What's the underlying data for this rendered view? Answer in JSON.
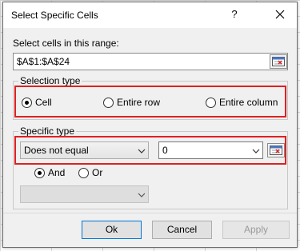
{
  "window": {
    "title": "Select Specific Cells",
    "help_label": "?"
  },
  "range": {
    "label": "Select cells in this range:",
    "value": "$A$1:$A$24"
  },
  "selection_type": {
    "title": "Selection type",
    "options": [
      "Cell",
      "Entire row",
      "Entire column"
    ],
    "selected": "Cell"
  },
  "specific_type": {
    "title": "Specific type",
    "condition1": "Does not equal",
    "value1": "0",
    "logic": {
      "and_label": "And",
      "or_label": "Or",
      "selected": "And"
    },
    "condition2": ""
  },
  "buttons": {
    "ok": "Ok",
    "cancel": "Cancel",
    "apply": "Apply"
  },
  "colors": {
    "highlight": "#e02020",
    "focus": "#0078d7"
  }
}
